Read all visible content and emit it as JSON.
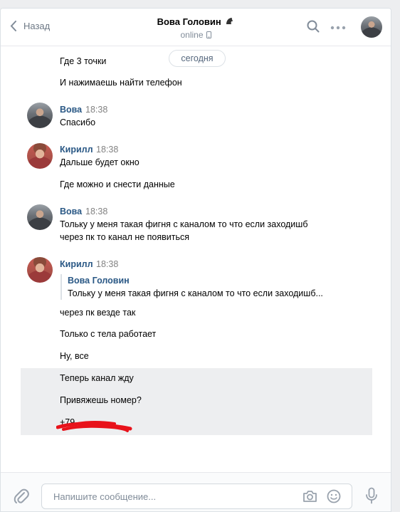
{
  "header": {
    "back_label": "Назад",
    "title": "Вова Головин",
    "status": "online"
  },
  "date_divider": "сегодня",
  "messages": [
    {
      "kind": "text",
      "text": "Где 3 точки"
    },
    {
      "kind": "text",
      "text": "И нажимаешь найти телефон"
    },
    {
      "kind": "group",
      "author": "Вова",
      "time": "18:38",
      "lines": [
        "Спасибо"
      ]
    },
    {
      "kind": "group",
      "author": "Кирилл",
      "time": "18:38",
      "lines": [
        "Дальше будет окно",
        "Где можно и снести данные"
      ]
    },
    {
      "kind": "group",
      "author": "Вова",
      "time": "18:38",
      "lines": [
        "Тольку у меня такая фигня с каналом то что если заходишб",
        "через пк то канал не появиться"
      ]
    },
    {
      "kind": "group",
      "author": "Кирилл",
      "time": "18:38",
      "quote": {
        "author": "Вова Головин",
        "text": "Тольку у меня такая фигня с каналом то что если заходишб..."
      },
      "lines": [
        "через пк везде так",
        "Только с тела работает",
        "Ну, все",
        "Теперь канал жду",
        "Привяжешь номер?",
        "+79"
      ]
    }
  ],
  "composer": {
    "placeholder": "Напишите сообщение..."
  },
  "icons": [
    "chevron-left-icon",
    "phone-icon",
    "search-icon",
    "more-icon",
    "paperclip-icon",
    "camera-icon",
    "smile-icon",
    "microphone-icon"
  ],
  "colors": {
    "link": "#2a5885",
    "muted": "#818c99",
    "selected_bg": "#edeef0",
    "redaction": "#e8121b"
  }
}
